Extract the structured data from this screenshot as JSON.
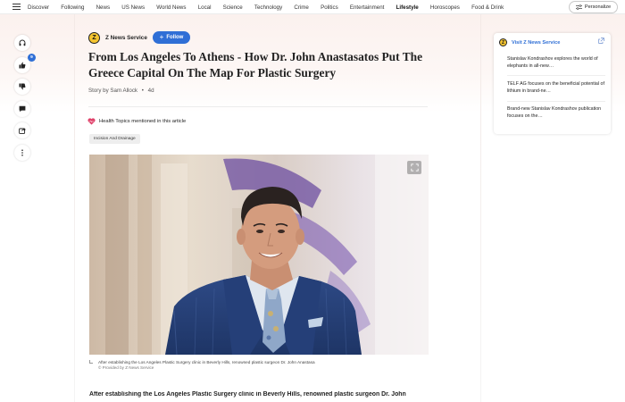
{
  "nav": {
    "items": [
      "Discover",
      "Following",
      "News",
      "US News",
      "World News",
      "Local",
      "Science",
      "Technology",
      "Crime",
      "Politics",
      "Entertainment",
      "Lifestyle",
      "Horoscopes",
      "Food & Drink"
    ],
    "active": "Lifestyle",
    "personalize_label": "Personalize"
  },
  "rail": {
    "likes_count": "9"
  },
  "article": {
    "publisher_initial": "Z",
    "publisher": "Z News Service",
    "follow_label": "Follow",
    "headline": "From Los Angeles To Athens - How Dr. John Anastasatos Put The Greece Capital On The Map For Plastic Surgery",
    "byline": "Story by Sam Allock",
    "bullet": "•",
    "age": "4d",
    "health_label": "Health Topics mentioned in this article",
    "tag": "Incision And Drainage",
    "caption": "After establishing the Los Angeles Plastic Surgery clinic in Beverly Hills, renowned plastic surgeon Dr. John Anastasa",
    "provided_by": "© Provided by Z News Service",
    "body_first_line": "After establishing the Los Angeles Plastic Surgery clinic in Beverly Hills, renowned plastic surgeon Dr. John"
  },
  "sidebar_card": {
    "initial": "Z",
    "title": "Visit Z News Service",
    "items": [
      "Stanislav Kondrashov explores the world of elephants in all-new…",
      "TELF AG focuses on the beneficial potential of lithium in brand-ne…",
      "Brand-new Stanislav Kondrashov publication focuses on the…"
    ]
  },
  "colors": {
    "accent": "#2f6fd6",
    "brand_yellow": "#f4c430",
    "health_heart": "#e0436b"
  }
}
